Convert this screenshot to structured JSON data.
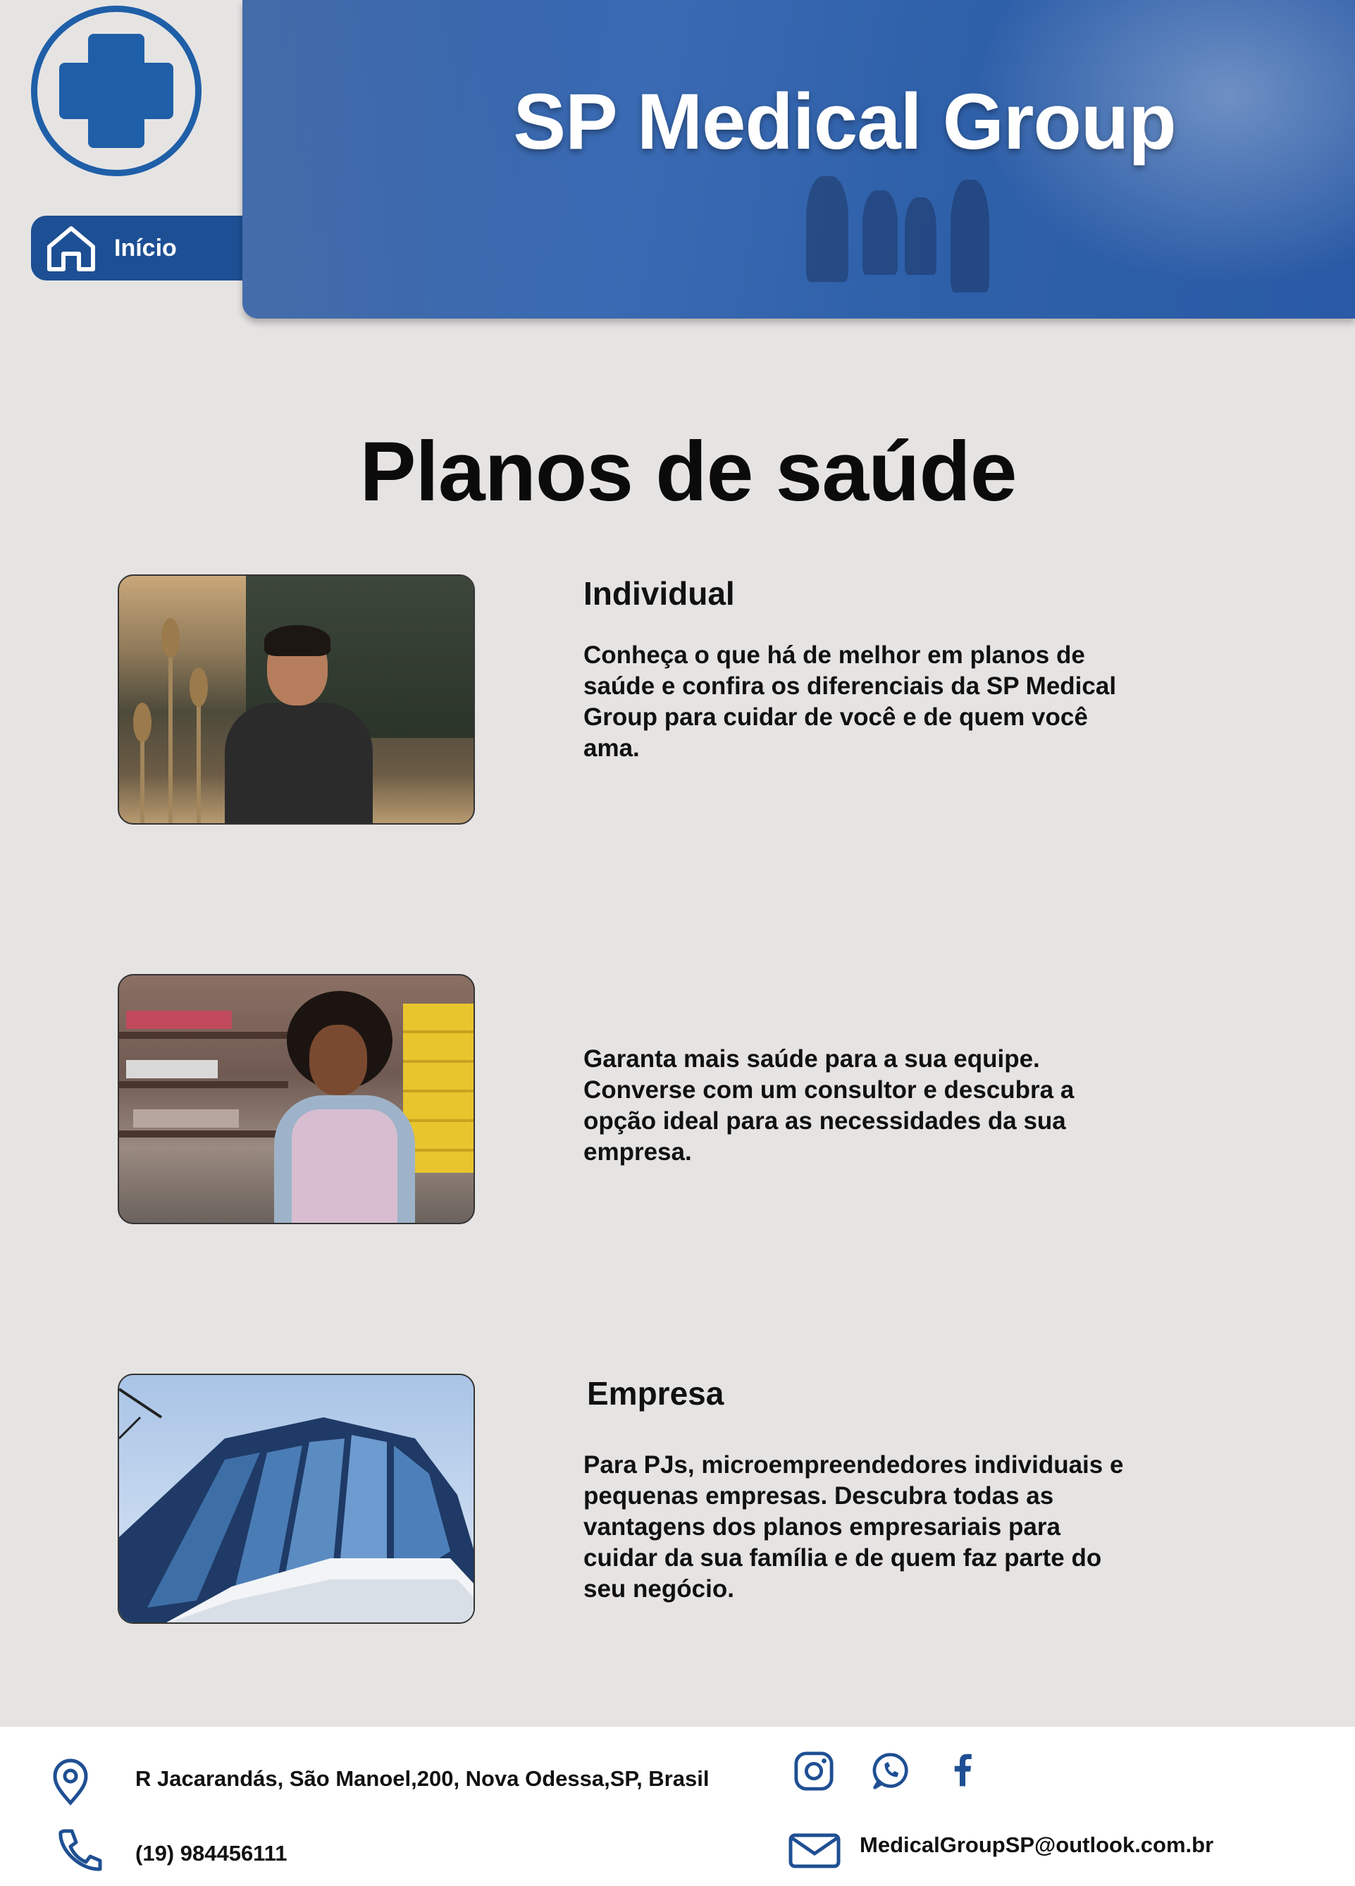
{
  "header": {
    "brand_title": "SP Medical Group",
    "nav_home_label": "Início"
  },
  "main": {
    "page_title": "Planos de saúde",
    "plans": [
      {
        "title": "Individual",
        "description": "Conheça o que há de melhor em planos de saúde e confira os diferenciais da SP Medical Group para cuidar de você e de quem você ama."
      },
      {
        "title": "",
        "description": "Garanta mais saúde para a sua equipe. Converse com um consultor e descubra a opção ideal para as necessidades da sua empresa."
      },
      {
        "title": "Empresa",
        "description": "Para PJs, microempreendedores individuais e pequenas empresas. Descubra todas as vantagens dos planos empresariais para cuidar da sua família e de quem faz parte do seu negócio."
      }
    ]
  },
  "footer": {
    "address": "R Jacarandás, São Manoel,200, Nova Odessa,SP, Brasil",
    "phone": "(19) 984456111",
    "email": "MedicalGroupSP@outlook.com.br",
    "social_icons": [
      "instagram-icon",
      "whatsapp-icon",
      "facebook-icon"
    ]
  },
  "colors": {
    "brand_blue": "#1f5fa8",
    "nav_blue": "#1d4f94",
    "page_background": "#e6e4e3",
    "footer_background": "#ffffff"
  }
}
